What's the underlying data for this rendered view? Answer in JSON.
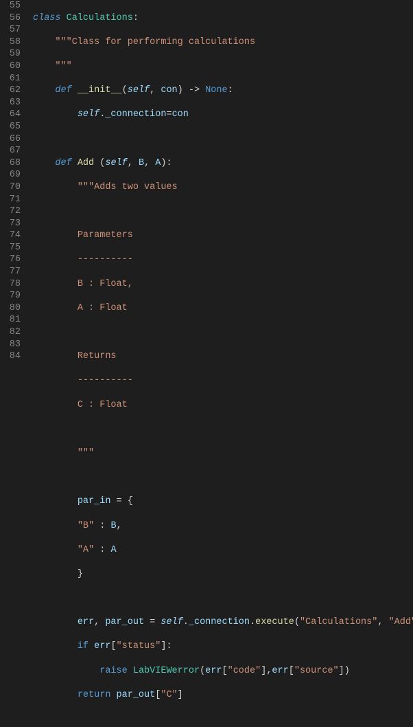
{
  "line_numbers": [
    "55",
    "56",
    "57",
    "58",
    "59",
    "60",
    "61",
    "62",
    "63",
    "64",
    "65",
    "66",
    "67",
    "68",
    "69",
    "70",
    "71",
    "72",
    "73",
    "74",
    "75",
    "76",
    "77",
    "78",
    "79",
    "80",
    "81",
    "82",
    "83",
    "84"
  ],
  "code": {
    "kw_class": "class",
    "cls_name": "Calculations",
    "colon": ":",
    "docstring_class": "\"\"\"Class for performing calculations",
    "triple_quote": "\"\"\"",
    "kw_def": "def",
    "fn_init": "__init__",
    "kw_self": "self",
    "p_con": "con",
    "arrow": " -> ",
    "none_kw": "None",
    "init_body": "self._connection=con",
    "init_self": "self",
    "init_dot": ".",
    "init_attr": "_connection",
    "init_eq": "=",
    "init_con": "con",
    "fn_add": "Add",
    "p_B": "B",
    "p_A": "A",
    "doc_add": "\"\"\"Adds two values",
    "doc_params": "Parameters",
    "doc_dash": "----------",
    "doc_B": "B : Float,",
    "doc_A": "A : Float",
    "doc_returns": "Returns",
    "doc_C": "C : Float",
    "par_in": "par_in",
    "par_in_eq": " = {",
    "key_B": "\"B\"",
    "key_A": "\"A\"",
    "map_sep": " : ",
    "comma": ",",
    "brace_close": "}",
    "err": "err",
    "par_out": "par_out",
    "assign_sep": ", ",
    "eq": " = ",
    "conn_self": "self",
    "conn_attr": "_connection",
    "conn_exec": "execute",
    "str_calc": "\"Calculations\"",
    "str_add": "\"Add\"",
    "kw_if": "if",
    "err_status": "\"status\"",
    "kw_raise": "raise",
    "lv_err": "LabVIEWerror",
    "err_code": "\"code\"",
    "err_source": "\"source\"",
    "kw_return": "return",
    "ret_key": "\"C\"",
    "sp1": " ",
    "lp": "(",
    "rp": ")",
    "lb": "[",
    "rb": "]",
    "dot": "."
  }
}
